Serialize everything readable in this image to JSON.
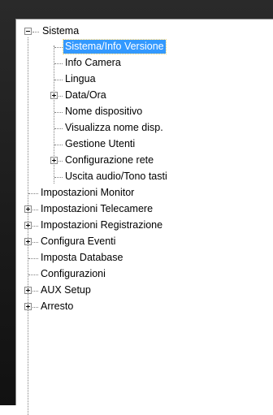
{
  "tree": {
    "root": {
      "label": "Sistema",
      "expanded": true,
      "children": [
        {
          "label": "Sistema/Info Versione",
          "selected": true
        },
        {
          "label": "Info Camera"
        },
        {
          "label": "Lingua"
        },
        {
          "label": "Data/Ora",
          "expandable": true
        },
        {
          "label": "Nome dispositivo"
        },
        {
          "label": "Visualizza nome disp."
        },
        {
          "label": "Gestione Utenti"
        },
        {
          "label": "Configurazione rete",
          "expandable": true
        },
        {
          "label": "Uscita audio/Tono tasti"
        }
      ]
    },
    "top_items": [
      {
        "label": "Impostazioni Monitor",
        "expandable": false
      },
      {
        "label": "Impostazioni Telecamere",
        "expandable": true
      },
      {
        "label": "Impostazioni Registrazione",
        "expandable": true
      },
      {
        "label": "Configura Eventi",
        "expandable": true
      },
      {
        "label": "Imposta Database",
        "expandable": false
      },
      {
        "label": "Configurazioni",
        "expandable": false
      },
      {
        "label": "AUX Setup",
        "expandable": true
      },
      {
        "label": "Arresto",
        "expandable": true
      }
    ]
  },
  "colors": {
    "selection": "#3399ff",
    "selection_text": "#ffffff",
    "tree_lines": "#808080",
    "frame_background": "#1a1a1a"
  }
}
